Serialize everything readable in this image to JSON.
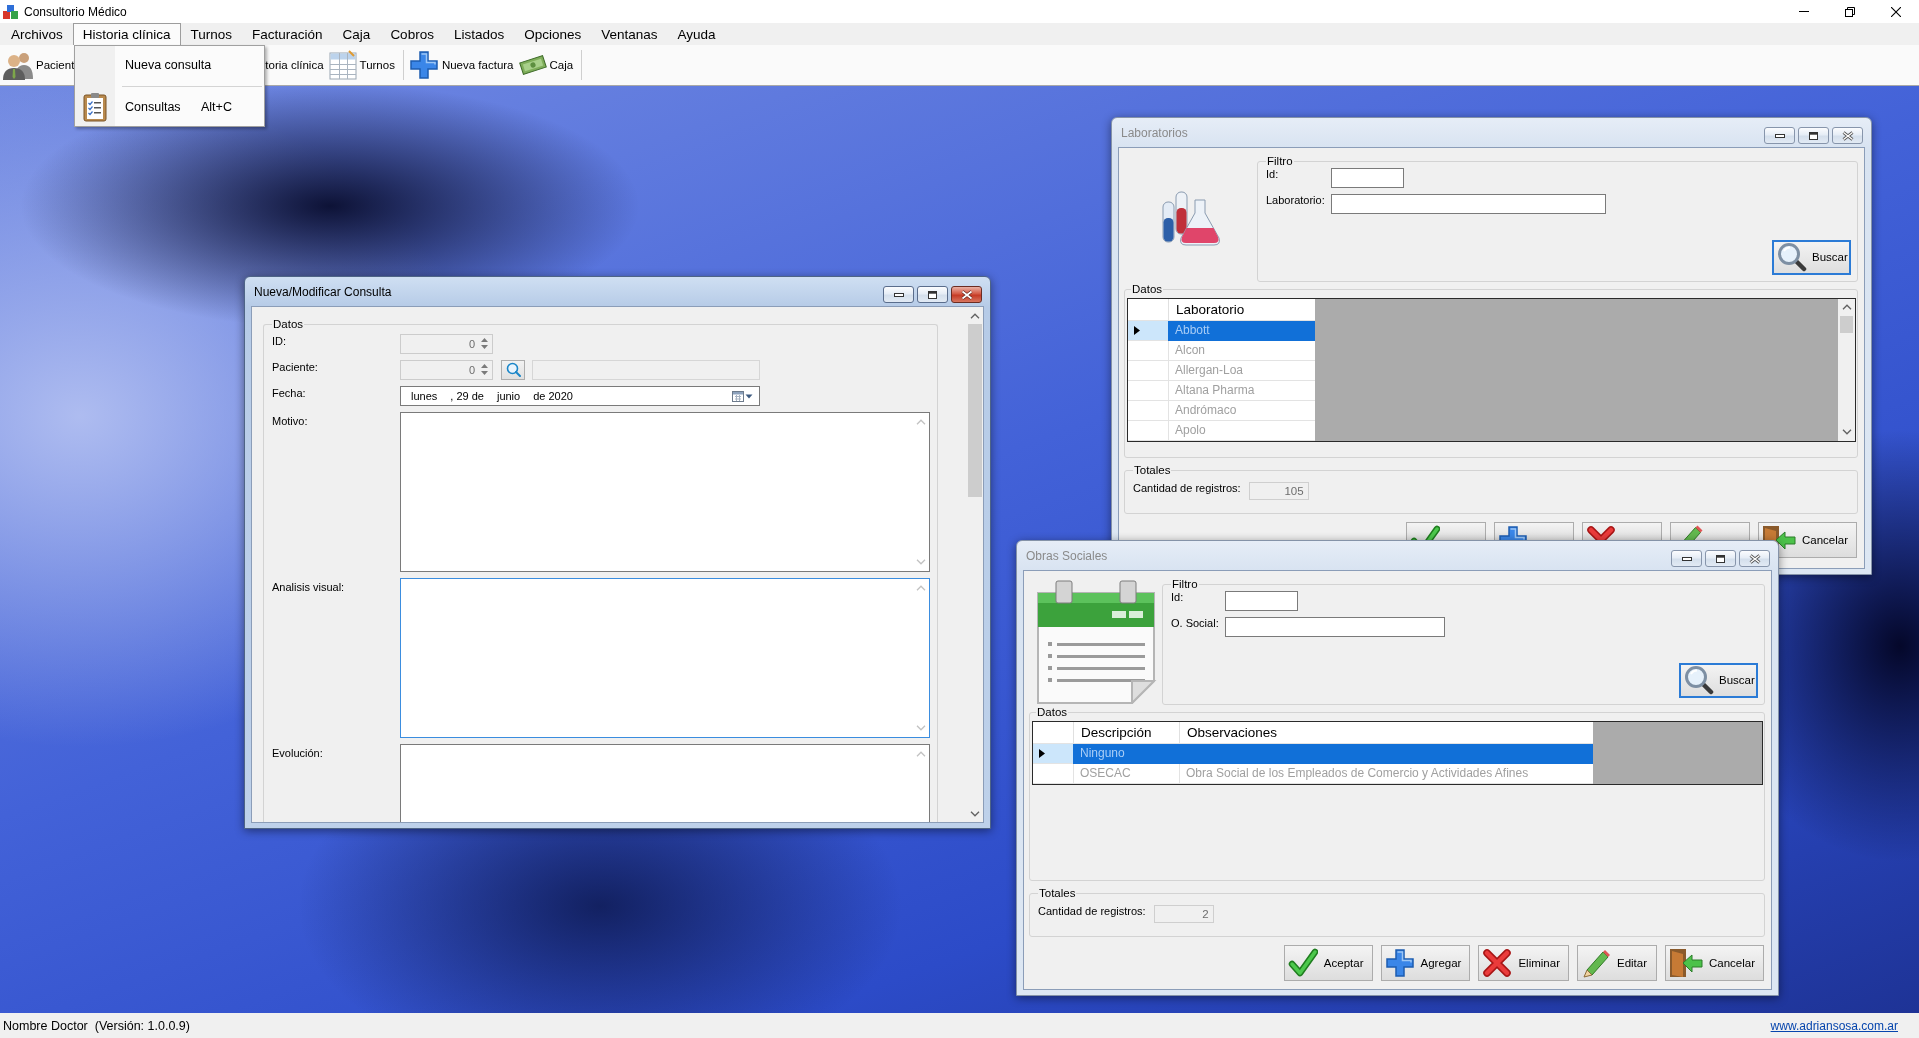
{
  "window": {
    "title": "Consultorio Médico"
  },
  "menu": [
    {
      "label": "Archivos",
      "selected": false
    },
    {
      "label": "Historia clínica",
      "selected": true
    },
    {
      "label": "Turnos",
      "selected": false
    },
    {
      "label": "Facturación",
      "selected": false
    },
    {
      "label": "Caja",
      "selected": false
    },
    {
      "label": "Cobros",
      "selected": false
    },
    {
      "label": "Listados",
      "selected": false
    },
    {
      "label": "Opciones",
      "selected": false
    },
    {
      "label": "Ventanas",
      "selected": false
    },
    {
      "label": "Ayuda",
      "selected": false
    }
  ],
  "menu_dropdown": [
    {
      "kind": "command",
      "label": "Nueva consulta"
    },
    {
      "kind": "separator"
    },
    {
      "kind": "icon_command",
      "label": "Consultas",
      "shortcut": "Alt+C"
    }
  ],
  "toolbar": [
    {
      "kind": "button",
      "label": "Pacient"
    },
    {
      "kind": "button",
      "label": "toria clínica"
    },
    {
      "kind": "button",
      "label": "Turnos"
    },
    {
      "kind": "separator"
    },
    {
      "kind": "button",
      "label": "Nueva factura"
    },
    {
      "kind": "button",
      "label": "Caja"
    },
    {
      "kind": "separator"
    }
  ],
  "consulta_form": {
    "title": "Nueva/Modificar Consulta",
    "active": true,
    "group_title": "Datos",
    "fields": [
      {
        "kind": "spinner",
        "label": "ID:",
        "value": "0",
        "disabled": true
      },
      {
        "kind": "spinner_lookup",
        "label": "Paciente:",
        "value": "0",
        "disabled": true
      },
      {
        "kind": "date",
        "label": "Fecha:",
        "parts": [
          "lunes",
          ", 29 de",
          "junio",
          "de 2020"
        ]
      },
      {
        "kind": "memo",
        "label": "Motivo:",
        "focused": false
      },
      {
        "kind": "memo",
        "label": "Analisis visual:",
        "focused": true
      },
      {
        "kind": "memo",
        "label": "Evolución:",
        "focused": false
      }
    ]
  },
  "laboratorios": {
    "title": "Laboratorios",
    "active": false,
    "filter": {
      "title": "Filtro",
      "fields": [
        {
          "kind": "short",
          "label": "Id:"
        },
        {
          "kind": "long",
          "label": "Laboratorio:"
        }
      ],
      "button": "Buscar"
    },
    "data_title": "Datos",
    "grid": {
      "columns": [
        "Laboratorio"
      ],
      "rows": [
        {
          "cells": [
            "Abbott"
          ],
          "selected": true
        },
        {
          "cells": [
            "Alcon"
          ],
          "selected": false
        },
        {
          "cells": [
            "Allergan-Loa"
          ],
          "selected": false
        },
        {
          "cells": [
            "Altana Pharma"
          ],
          "selected": false
        },
        {
          "cells": [
            "Andrómaco"
          ],
          "selected": false
        },
        {
          "cells": [
            "Apolo"
          ],
          "selected": false
        }
      ]
    },
    "totals": {
      "title": "Totales",
      "label": "Cantidad de registros:",
      "value": "105"
    },
    "buttons": [
      {
        "kind": "accept"
      },
      {
        "kind": "add"
      },
      {
        "kind": "delete"
      },
      {
        "kind": "edit"
      },
      {
        "kind": "cancel",
        "label": "Cancelar"
      }
    ]
  },
  "obras_sociales": {
    "title": "Obras Sociales",
    "active": false,
    "filter": {
      "title": "Filtro",
      "fields": [
        {
          "kind": "short",
          "label": "Id:"
        },
        {
          "kind": "long",
          "label": "O. Social:"
        }
      ],
      "button": "Buscar"
    },
    "data_title": "Datos",
    "grid": {
      "columns": [
        "Descripción",
        "Observaciones"
      ],
      "rows": [
        {
          "cells": [
            "Ninguno"
          ],
          "selected": true
        },
        {
          "cells": [
            "OSECAC",
            "Obra Social de los Empleados de Comercio y Actividades Afines"
          ],
          "selected": false
        }
      ]
    },
    "totals": {
      "title": "Totales",
      "label": "Cantidad de registros:",
      "value": "2"
    },
    "buttons": [
      {
        "kind": "accept",
        "label": "Aceptar"
      },
      {
        "kind": "add",
        "label": "Agregar"
      },
      {
        "kind": "delete",
        "label": "Eliminar"
      },
      {
        "kind": "edit",
        "label": "Editar"
      },
      {
        "kind": "cancel",
        "label": "Cancelar"
      }
    ]
  },
  "status_bar": {
    "user": "Nombre Doctor",
    "version": "(Versión: 1.0.0.9)",
    "link": "www.adriansosa.com.ar"
  }
}
